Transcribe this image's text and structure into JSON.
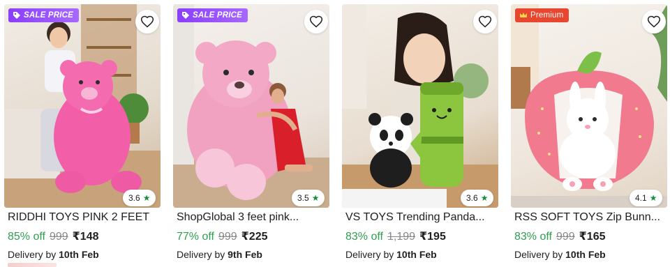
{
  "products": [
    {
      "badge": {
        "type": "sale",
        "label": "SALE PRICE"
      },
      "rating": "3.6",
      "title": "RIDDHI TOYS PINK 2 FEET",
      "discount": "85% off",
      "mrp": "999",
      "price": "₹148",
      "delivery_prefix": "Delivery by",
      "delivery_date": "10th Feb",
      "image_icon": "pink-teddy-bear-image"
    },
    {
      "badge": {
        "type": "sale",
        "label": "SALE PRICE"
      },
      "rating": "3.5",
      "title": "ShopGlobal 3 feet pink...",
      "discount": "77% off",
      "mrp": "999",
      "price": "₹225",
      "delivery_prefix": "Delivery by",
      "delivery_date": "9th Feb",
      "image_icon": "giant-pink-teddy-image"
    },
    {
      "badge": null,
      "rating": "3.6",
      "title": "VS TOYS Trending Panda...",
      "discount": "83% off",
      "mrp": "1,199",
      "price": "₹195",
      "delivery_prefix": "Delivery by",
      "delivery_date": "10th Feb",
      "image_icon": "panda-bamboo-plush-image"
    },
    {
      "badge": {
        "type": "premium",
        "label": "Premium"
      },
      "rating": "4.1",
      "title": "RSS SOFT TOYS Zip Bunn...",
      "discount": "83% off",
      "mrp": "999",
      "price": "₹165",
      "delivery_prefix": "Delivery by",
      "delivery_date": "10th Feb",
      "image_icon": "strawberry-bunny-plush-image"
    }
  ],
  "colors": {
    "sale_badge": "#8a3ffc",
    "premium_badge": "#e8462e",
    "discount": "#2e9e4f",
    "rating_star": "#1a8b3f",
    "mrp": "#878787"
  },
  "icons": {
    "wishlist": "heart-outline-icon",
    "rating": "star-icon",
    "sale": "tag-icon",
    "premium": "crown-icon"
  }
}
